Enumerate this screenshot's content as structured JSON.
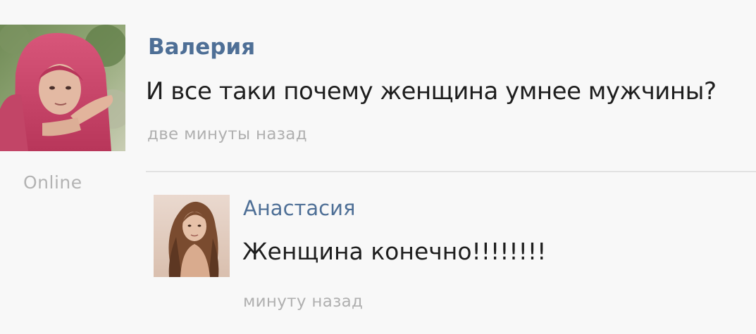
{
  "post": {
    "author": "Валерия",
    "text": "И все таки почему женщина умнее мужчины?",
    "time": "две минуты назад",
    "status": "Online",
    "avatar_icon": "user-photo-avatar"
  },
  "reply": {
    "author": "Анастасия",
    "text": "Женщина конечно!!!!!!!!",
    "time": "минуту назад",
    "avatar_icon": "user-photo-avatar"
  },
  "colors": {
    "author_link": "#4e6f96",
    "text": "#1e1e1e",
    "muted": "#b0b0b0",
    "background": "#f8f8f8"
  }
}
